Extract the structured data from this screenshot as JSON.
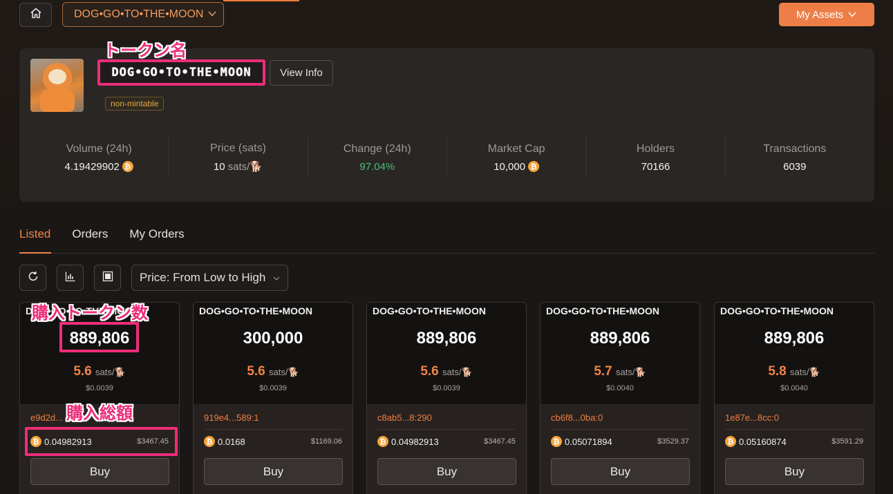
{
  "header": {
    "token_selector": "DOG•GO•TO•THE•MOON",
    "my_assets": "My Assets"
  },
  "token": {
    "name": "DOG•GO•TO•THE•MOON",
    "view_info": "View Info",
    "badge": "non-mintable"
  },
  "stats": [
    {
      "label": "Volume (24h)",
      "value": "4.19429902",
      "unit": "",
      "icon": "btc-icon"
    },
    {
      "label": "Price (sats)",
      "value": "10",
      "unit": "sats/🐕",
      "icon": ""
    },
    {
      "label": "Change (24h)",
      "value": "97.04%",
      "unit": "",
      "icon": ""
    },
    {
      "label": "Market Cap",
      "value": "10,000",
      "unit": "",
      "icon": "btc-icon"
    },
    {
      "label": "Holders",
      "value": "70166",
      "unit": "",
      "icon": ""
    },
    {
      "label": "Transactions",
      "value": "6039",
      "unit": "",
      "icon": ""
    }
  ],
  "tabs": [
    "Listed",
    "Orders",
    "My Orders"
  ],
  "toolbar": {
    "sort": "Price: From Low to High"
  },
  "annotations": {
    "token_name": "トークン名",
    "token_amount": "購入トークン数",
    "total_price": "購入総額"
  },
  "listings": [
    {
      "title": "DOG•GO•TO•THE•MOON",
      "amount": "889,806",
      "price": "5.6",
      "unit": "sats/🐕",
      "usd": "$0.0039",
      "id": "e9d2d...",
      "total_btc": "0.04982913",
      "total_usd": "$3467.45",
      "buy": "Buy"
    },
    {
      "title": "DOG•GO•TO•THE•MOON",
      "amount": "300,000",
      "price": "5.6",
      "unit": "sats/🐕",
      "usd": "$0.0039",
      "id": "919e4...589:1",
      "total_btc": "0.0168",
      "total_usd": "$1169.06",
      "buy": "Buy"
    },
    {
      "title": "DOG•GO•TO•THE•MOON",
      "amount": "889,806",
      "price": "5.6",
      "unit": "sats/🐕",
      "usd": "$0.0039",
      "id": "c8ab5...8:290",
      "total_btc": "0.04982913",
      "total_usd": "$3467.45",
      "buy": "Buy"
    },
    {
      "title": "DOG•GO•TO•THE•MOON",
      "amount": "889,806",
      "price": "5.7",
      "unit": "sats/🐕",
      "usd": "$0.0040",
      "id": "cb6f8...0ba:0",
      "total_btc": "0.05071894",
      "total_usd": "$3529.37",
      "buy": "Buy"
    },
    {
      "title": "DOG•GO•TO•THE•MOON",
      "amount": "889,806",
      "price": "5.8",
      "unit": "sats/🐕",
      "usd": "$0.0040",
      "id": "1e87e...8cc:0",
      "total_btc": "0.05160874",
      "total_usd": "$3591.29",
      "buy": "Buy"
    }
  ]
}
